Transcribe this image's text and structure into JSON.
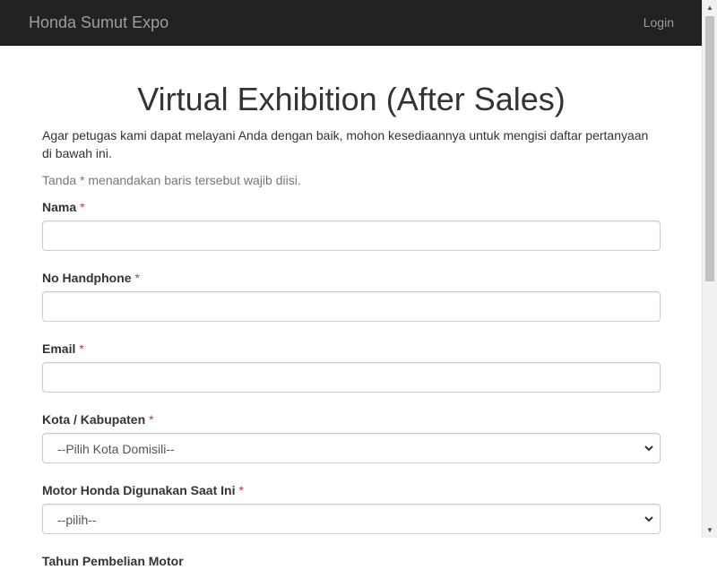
{
  "navbar": {
    "brand": "Honda Sumut Expo",
    "login_label": "Login"
  },
  "page": {
    "title": "Virtual Exhibition (After Sales)",
    "intro": "Agar petugas kami dapat melayani Anda dengan baik, mohon kesediaannya untuk mengisi daftar pertanyaan di bawah ini.",
    "required_note": "Tanda * menandakan baris tersebut wajib diisi."
  },
  "form": {
    "required_marker": "*",
    "fields": [
      {
        "label": "Nama",
        "type": "text",
        "value": ""
      },
      {
        "label": "No Handphone",
        "type": "text",
        "value": ""
      },
      {
        "label": "Email",
        "type": "text",
        "value": ""
      },
      {
        "label": "Kota / Kabupaten",
        "type": "select",
        "selected": "--Pilih Kota Domisili--"
      },
      {
        "label": "Motor Honda Digunakan Saat Ini",
        "type": "select",
        "selected": "--pilih--"
      },
      {
        "label": "Tahun Pembelian Motor",
        "type": "partial"
      }
    ]
  },
  "icons": {
    "select_arrow": "chevron-down-icon",
    "scroll_up": "scroll-up-arrow-icon",
    "scroll_down": "scroll-down-arrow-icon"
  },
  "colors": {
    "navbar_bg": "#222222",
    "navbar_text": "#9d9d9d",
    "required": "#a94442",
    "muted": "#777777",
    "input_border": "#cccccc"
  }
}
